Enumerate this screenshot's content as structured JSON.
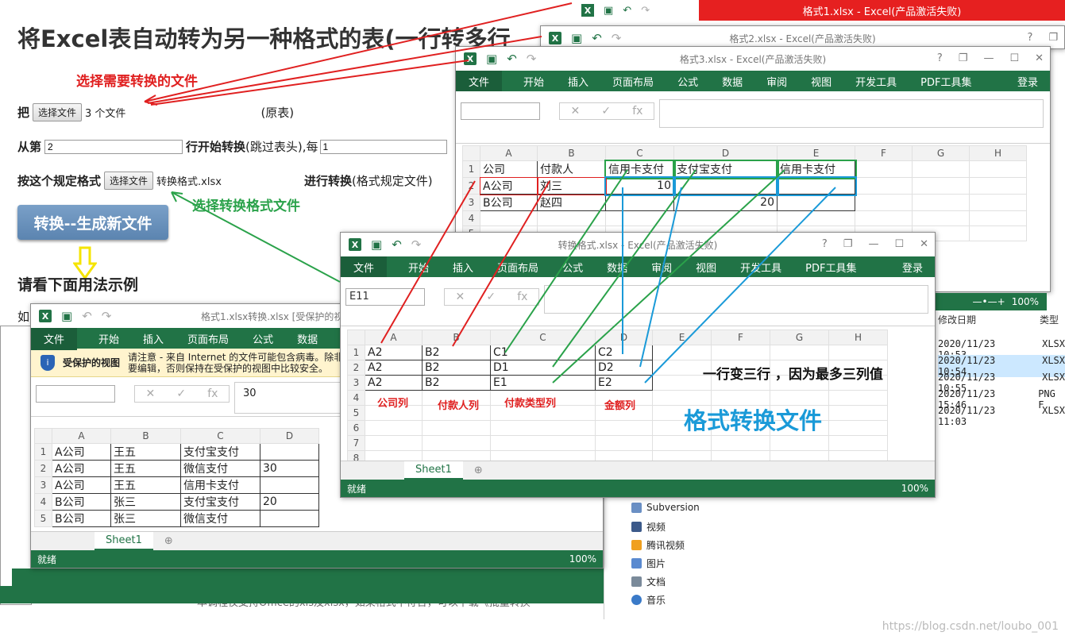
{
  "page": {
    "title": "将Excel表自动转为另一种格式的表(一行转多行",
    "row1_prefix": "把",
    "file_btn": "选择文件",
    "row1_files": "3 个文件",
    "row1_suffix": "(原表)",
    "row2_prefix": "从第",
    "row2_value": "2",
    "row2_mid": "行开始转换",
    "row2_note": "(跳过表头),每",
    "row2_value2": "1",
    "row3_prefix": "按这个规定格式",
    "row3_file": "转换格式.xlsx",
    "row3_suffix": "进行转换",
    "row3_note": "(格式规定文件)",
    "convert_btn": "转换--生成新文件",
    "section_head": "请看下面用法示例",
    "partial_text": "如",
    "bottom_text": "本调程仅支持Office的xls及xlsx，如果格式不符合，可以下载《批量转换"
  },
  "annotations": {
    "choose_files": "选择需要转换的文件",
    "choose_format": "选择转换格式文件",
    "one_row_three": "一行变三行 ，因为最多三列值",
    "format_file": "格式转换文件",
    "company_col": "公司列",
    "payer_col": "付款人列",
    "pay_type_col": "付款类型列",
    "amount_col": "金额列"
  },
  "ribbon": [
    "文件",
    "开始",
    "插入",
    "页面布局",
    "公式",
    "数据",
    "审阅",
    "视图",
    "开发工具",
    "PDF工具集"
  ],
  "login": "登录",
  "win_top": {
    "title": "格式1.xlsx  -  Excel(产品激活失败)"
  },
  "win2": {
    "title": "格式2.xlsx - Excel(产品激活失败)"
  },
  "win3": {
    "title": "格式3.xlsx - Excel(产品激活失败)",
    "cols": [
      "A",
      "B",
      "C",
      "D",
      "E",
      "F",
      "G",
      "H"
    ],
    "rows": [
      [
        "公司",
        "付款人",
        "信用卡支付",
        "支付宝支付",
        "信用卡支付"
      ],
      [
        "A公司",
        "刘三",
        "10",
        "",
        ""
      ],
      [
        "B公司",
        "赵四",
        "",
        "20",
        ""
      ]
    ],
    "row_nums": [
      "1",
      "2",
      "3",
      "4",
      "5"
    ]
  },
  "win_format": {
    "title": "转换格式.xlsx - Excel(产品激活失败)",
    "namebox": "E11",
    "cols": [
      "A",
      "B",
      "C",
      "D",
      "E",
      "F",
      "G",
      "H"
    ],
    "rows": [
      [
        "A2",
        "B2",
        "C1",
        "C2"
      ],
      [
        "A2",
        "B2",
        "D1",
        "D2"
      ],
      [
        "A2",
        "B2",
        "E1",
        "E2"
      ]
    ],
    "row_nums": [
      "1",
      "2",
      "3",
      "4",
      "5",
      "6",
      "7",
      "8"
    ],
    "sheet": "Sheet1",
    "status": "就绪",
    "zoom": "100%"
  },
  "win1": {
    "title": "格式1.xlsx转换.xlsx  [受保护的视图]",
    "protected_label": "受保护的视图",
    "protected_msg": "请注意 - 来自 Internet 的文件可能包含病毒。除非您需要编辑，否则保持在受保护的视图中比较安全。",
    "fx_value": "30",
    "cols": [
      "A",
      "B",
      "C",
      "D"
    ],
    "rows": [
      [
        "A公司",
        "王五",
        "支付宝支付",
        ""
      ],
      [
        "A公司",
        "王五",
        "微信支付",
        "30"
      ],
      [
        "A公司",
        "王五",
        "信用卡支付",
        ""
      ],
      [
        "B公司",
        "张三",
        "支付宝支付",
        "20"
      ],
      [
        "B公司",
        "张三",
        "微信支付",
        ""
      ]
    ],
    "sheet": "Sheet1",
    "status": "就绪",
    "zoom": "100%"
  },
  "explorer": {
    "headers": [
      "修改日期",
      "类型"
    ],
    "files": [
      {
        "date": "2020/11/23 10:53",
        "type": "XLSX"
      },
      {
        "date": "2020/11/23 10:54",
        "type": "XLSX"
      },
      {
        "date": "2020/11/23 10:55",
        "type": "XLSX"
      },
      {
        "date": "2020/11/23 15:46",
        "type": "PNG F"
      },
      {
        "date": "2020/11/23 11:03",
        "type": "XLSX"
      }
    ],
    "nav": [
      "Subversion",
      "视频",
      "腾讯视频",
      "图片",
      "文档",
      "音乐"
    ],
    "zoom": "100%"
  },
  "watermark": "https://blog.csdn.net/loubo_001",
  "colors": {
    "excel_green": "#217346",
    "red_annot": "#e02020",
    "green_annot": "#2aa24a",
    "blue_annot": "#1a9ad8"
  }
}
